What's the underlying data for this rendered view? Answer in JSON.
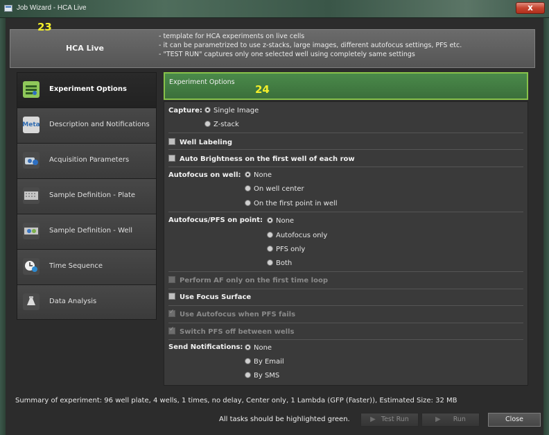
{
  "window": {
    "title": "Job Wizard - HCA Live",
    "close_glyph": "x"
  },
  "banner": {
    "title": "HCA Live",
    "number_23": "23",
    "lines": [
      "- template for HCA experiments on live cells",
      "- it can be parametrized to use z-stacks, large images, different autofocus settings, PFS etc.",
      "- \"TEST RUN\" captures only one selected well using completely same settings"
    ]
  },
  "nav": {
    "items": [
      {
        "label": "Experiment Options",
        "icon": "experiment-options-icon",
        "active": true
      },
      {
        "label": "Description and Notifications",
        "icon": "meta-icon",
        "active": false
      },
      {
        "label": "Acquisition Parameters",
        "icon": "camera-icon",
        "active": false
      },
      {
        "label": "Sample Definition - Plate",
        "icon": "plate-icon",
        "active": false
      },
      {
        "label": "Sample Definition - Well",
        "icon": "well-icon",
        "active": false
      },
      {
        "label": "Time Sequence",
        "icon": "clock-icon",
        "active": false
      },
      {
        "label": "Data Analysis",
        "icon": "analysis-icon",
        "active": false
      }
    ],
    "meta_icon_text": "Meta"
  },
  "panel": {
    "header": "Experiment Options",
    "number_24": "24",
    "capture": {
      "label": "Capture:",
      "options": [
        "Single Image",
        "Z-stack"
      ],
      "selected": "Single Image"
    },
    "well_labeling": "Well Labeling",
    "auto_brightness": "Auto Brightness on the first well of each row",
    "autofocus_well": {
      "label": "Autofocus on well:",
      "options": [
        "None",
        "On well center",
        "On the first point in well"
      ],
      "selected": "None"
    },
    "autofocus_pfs": {
      "label": "Autofocus/PFS on point:",
      "options": [
        "None",
        "Autofocus only",
        "PFS only",
        "Both"
      ],
      "selected": "None"
    },
    "perform_af": "Perform AF only on the first time loop",
    "use_focus_surface": "Use Focus Surface",
    "use_autofocus_pfs": "Use Autofocus when PFS fails",
    "switch_pfs": "Switch PFS off between wells",
    "notifications": {
      "label": "Send Notifications:",
      "options": [
        "None",
        "By Email",
        "By SMS"
      ],
      "selected": "None"
    }
  },
  "footer": {
    "summary": "Summary of experiment: 96 well plate, 4 wells, 1 times, no delay, Center only, 1 Lambda (GFP (Faster)), Estimated Size: 32 MB",
    "message": "All tasks should be highlighted green.",
    "test_run": "Test Run",
    "run": "Run",
    "close": "Close"
  },
  "colors": {
    "accent_green": "#88c24a",
    "header_green": "#3b6f3b",
    "annotation_yellow": "#f3ef2a"
  }
}
